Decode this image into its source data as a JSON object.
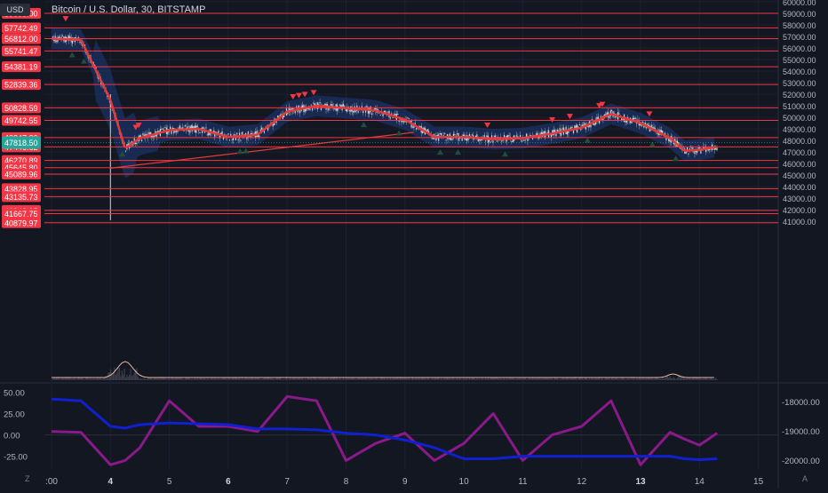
{
  "chart_title": "Bitcoin / U.S. Dollar, 30, BITSTAMP",
  "currency_button": "USD",
  "x_axis_labels": [
    ":00",
    "4",
    "5",
    "6",
    "7",
    "8",
    "9",
    "10",
    "11",
    "12",
    "13",
    "14",
    "15"
  ],
  "bold_x_labels": [
    "4",
    "6",
    "13"
  ],
  "price_axis_labels": [
    "60000.00",
    "59000.00",
    "58000.00",
    "57000.00",
    "56000.00",
    "55000.00",
    "54000.00",
    "53000.00",
    "52000.00",
    "51000.00",
    "50000.00",
    "49000.00",
    "48000.00",
    "47000.00",
    "46000.00",
    "45000.00",
    "44000.00",
    "43000.00",
    "42000.00",
    "41000.00"
  ],
  "horizontal_level_labels": [
    "59000.00",
    "57742.49",
    "56812.00",
    "55741.47",
    "54381.19",
    "52839.36",
    "50828.59",
    "49742.55",
    "48247.20",
    "47446.62",
    "46270.89",
    "45645.80",
    "45089.96",
    "43828.95",
    "43135.73",
    "41942.05",
    "41667.75",
    "40879.97"
  ],
  "current_price_label": "47818.50",
  "indicator_left_axis": [
    "50.00",
    "25.00",
    "0.00",
    "-25.00"
  ],
  "indicator_right_axis": [
    "-18000.00",
    "-19000.00",
    "-20000.00"
  ],
  "bottom_buttons": [
    "Z",
    "A"
  ],
  "colors": {
    "background": "#131722",
    "level_line": "#f23645",
    "level_label_bg": "#f23645",
    "ma_line": "#e53935",
    "band_fill": "#1e3a78",
    "candle_up": "#26a69a",
    "candle_down": "#ef5350",
    "current_price_bg": "#26a69a",
    "indicator_blue": "#1020d0",
    "indicator_purple": "#8a1a8a",
    "sell_marker": "#f23645",
    "buy_marker": "#1f4e3d"
  },
  "chart_data": {
    "type": "line",
    "title": "Bitcoin / U.S. Dollar, 30, BITSTAMP",
    "x_tick_labels": [
      ":00",
      "4",
      "5",
      "6",
      "7",
      "8",
      "9",
      "10",
      "11",
      "12",
      "13",
      "14",
      "15"
    ],
    "x_axis_days": [
      3,
      3.5,
      4,
      4.25,
      4.5,
      5,
      5.5,
      6,
      6.5,
      7,
      7.5,
      8,
      8.5,
      9,
      9.5,
      10,
      10.5,
      11,
      11.5,
      12,
      12.5,
      13,
      13.5,
      13.75,
      14,
      14.3
    ],
    "ylim": [
      40700,
      60500
    ],
    "series": [
      {
        "values": [
          56800,
          56700,
          51500,
          47300,
          48200,
          48900,
          49000,
          48300,
          48500,
          50500,
          51000,
          50800,
          50600,
          49800,
          48300,
          48300,
          48100,
          48200,
          48600,
          49100,
          50300,
          49500,
          48200,
          47100,
          47200,
          47450
        ]
      }
    ],
    "horizontal_levels": [
      59000.0,
      57742.49,
      56812.0,
      55741.47,
      54381.19,
      52839.36,
      50828.59,
      49742.55,
      48247.2,
      47446.62,
      46270.89,
      45645.8,
      45089.96,
      43828.95,
      43135.73,
      41942.05,
      41667.75,
      40879.97
    ],
    "current_price": 47818.5,
    "indicator": {
      "left_ylim": [
        -40,
        60
      ],
      "right_ylim": [
        -20300,
        -17400
      ],
      "blue": [
        42,
        40,
        10,
        8,
        12,
        14,
        13,
        12,
        7,
        7,
        6,
        2,
        0,
        -6,
        -15,
        -28,
        -28,
        -25,
        -25,
        -25,
        -25,
        -25,
        -25,
        -28,
        -29,
        -28
      ],
      "purple": [
        4,
        3,
        -35,
        -30,
        -15,
        40,
        10,
        10,
        4,
        45,
        40,
        -30,
        -10,
        2,
        -30,
        -10,
        25,
        -30,
        0,
        10,
        40,
        -35,
        3,
        -5,
        -12,
        2
      ]
    }
  }
}
